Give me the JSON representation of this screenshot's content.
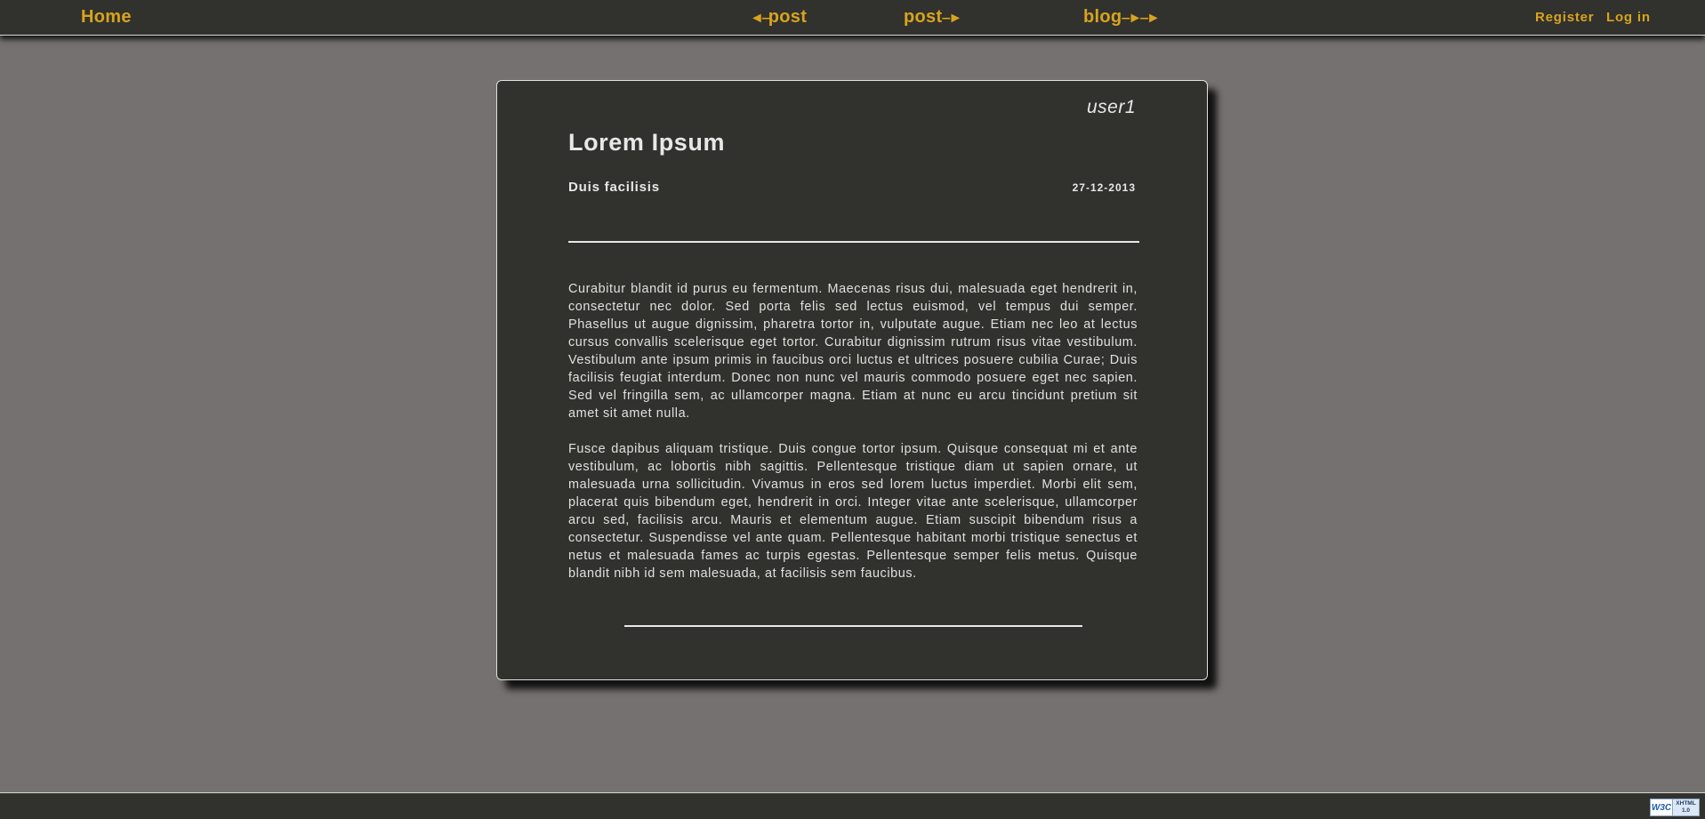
{
  "nav": {
    "home": "Home",
    "prev_post": "post",
    "next_post": "post",
    "blog": "blog",
    "register": "Register",
    "login": "Log in"
  },
  "post": {
    "author": "user1",
    "title": "Lorem Ipsum",
    "subtitle": "Duis facilisis",
    "date": "27-12-2013",
    "paragraphs": [
      "Curabitur blandit id purus eu fermentum. Maecenas risus dui, malesuada eget hendrerit in, consectetur nec dolor. Sed porta felis sed lectus euismod, vel tempus dui semper. Phasellus ut augue dignissim, pharetra tortor in, vulputate augue. Etiam nec leo at lectus cursus convallis scelerisque eget tortor. Curabitur dignissim rutrum risus vitae vestibulum. Vestibulum ante ipsum primis in faucibus orci luctus et ultrices posuere cubilia Curae; Duis facilisis feugiat interdum. Donec non nunc vel mauris commodo posuere eget nec sapien. Sed vel fringilla sem, ac ullamcorper magna. Etiam at nunc eu arcu tincidunt pretium sit amet sit amet nulla.",
      "Fusce dapibus aliquam tristique. Duis congue tortor ipsum. Quisque consequat mi et ante vestibulum, ac lobortis nibh sagittis. Pellentesque tristique diam ut sapien ornare, ut malesuada urna sollicitudin. Vivamus in eros sed lorem luctus imperdiet. Morbi elit sem, placerat quis bibendum eget, hendrerit in orci. Integer vitae ante scelerisque, ullamcorper arcu sed, facilisis arcu. Mauris et elementum augue. Etiam suscipit bibendum risus a consectetur. Suspendisse vel ante quam. Pellentesque habitant morbi tristique senectus et netus et malesuada fames ac turpis egestas. Pellentesque semper felis metus. Quisque blandit nibh id sem malesuada, at facilisis sem faucibus."
    ]
  },
  "footer": {
    "badge_logo": "W3C",
    "badge_line1": "XHTML",
    "badge_line2": "1.0",
    "badge_icon": "w3c-xhtml-validator-badge"
  },
  "colors": {
    "background": "#747170",
    "panel": "#31322d",
    "accent": "#d9a31f",
    "text": "#e8e8e8"
  }
}
